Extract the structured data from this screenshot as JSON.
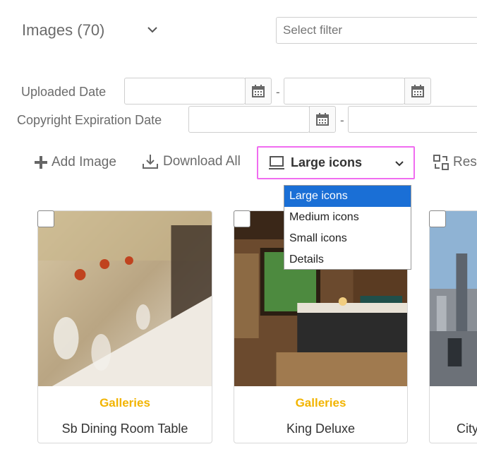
{
  "header": {
    "title": "Images (70)",
    "filter_placeholder": "Select filter"
  },
  "date_filters": {
    "uploaded_label": "Uploaded Date",
    "copyright_label": "Copyright Expiration Date",
    "separator": "-"
  },
  "toolbar": {
    "add_image_label": "Add Image",
    "download_all_label": "Download All",
    "view_selected": "Large icons",
    "reset_label": "Res"
  },
  "view_dropdown": {
    "options": [
      "Large icons",
      "Medium icons",
      "Small icons",
      "Details"
    ],
    "selected_index": 0
  },
  "cards": [
    {
      "category": "Galleries",
      "name": "Sb Dining Room Table"
    },
    {
      "category": "Galleries",
      "name": "King Deluxe"
    },
    {
      "category": "",
      "name": "City"
    }
  ],
  "colors": {
    "accent_category": "#f2b400",
    "dropdown_selected": "#1a6fd6",
    "highlight_border": "#f06cf0"
  }
}
